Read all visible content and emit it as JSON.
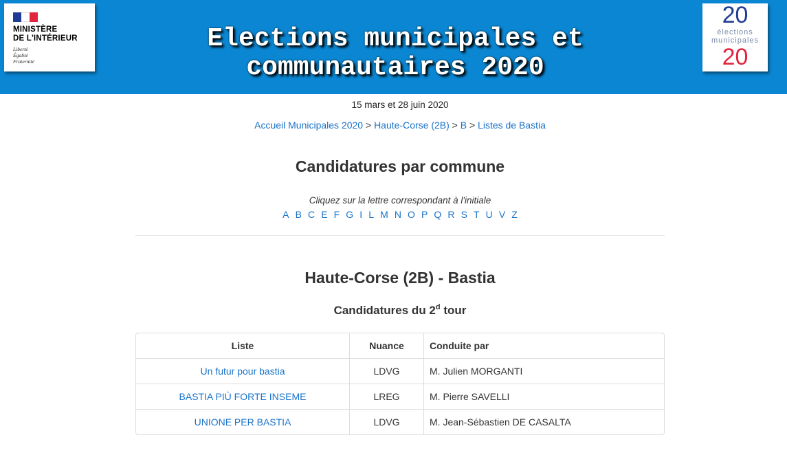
{
  "header": {
    "ministry": {
      "line1": "MINISTÈRE",
      "line2": "DE L'INTÉRIEUR",
      "motto": [
        "Liberté",
        "Égalité",
        "Fraternité"
      ]
    },
    "title_line1": "Elections municipales et",
    "title_line2": "communautaires 2020",
    "logo_right": {
      "top": "20",
      "middle": [
        "élections",
        "municipales"
      ],
      "bottom": "20"
    },
    "colors": {
      "banner": "#0a86d2",
      "blue": "#1f3c94",
      "red": "#e2253d"
    }
  },
  "dates": "15 mars et 28 juin 2020",
  "breadcrumb": {
    "items": [
      "Accueil Municipales 2020",
      "Haute-Corse (2B)",
      "B",
      "Listes de Bastia"
    ],
    "separator": ">"
  },
  "candidatures_heading": "Candidatures par commune",
  "hint": "Cliquez sur la lettre correspondant à l'initiale",
  "letters": [
    "A",
    "B",
    "C",
    "E",
    "F",
    "G",
    "I",
    "L",
    "M",
    "N",
    "O",
    "P",
    "Q",
    "R",
    "S",
    "T",
    "U",
    "V",
    "Z"
  ],
  "commune_heading": "Haute-Corse (2B) - Bastia",
  "tour_heading": {
    "prefix": "Candidatures du 2",
    "sup": "d",
    "suffix": " tour"
  },
  "table": {
    "headers": [
      "Liste",
      "Nuance",
      "Conduite par"
    ],
    "rows": [
      {
        "liste": "Un futur pour bastia",
        "nuance": "LDVG",
        "conduite": "M. Julien MORGANTI"
      },
      {
        "liste": "BASTIA PIÙ FORTE INSEME",
        "nuance": "LREG",
        "conduite": "M. Pierre SAVELLI"
      },
      {
        "liste": "UNIONE PER BASTIA",
        "nuance": "LDVG",
        "conduite": "M. Jean-Sébastien DE CASALTA"
      }
    ]
  }
}
